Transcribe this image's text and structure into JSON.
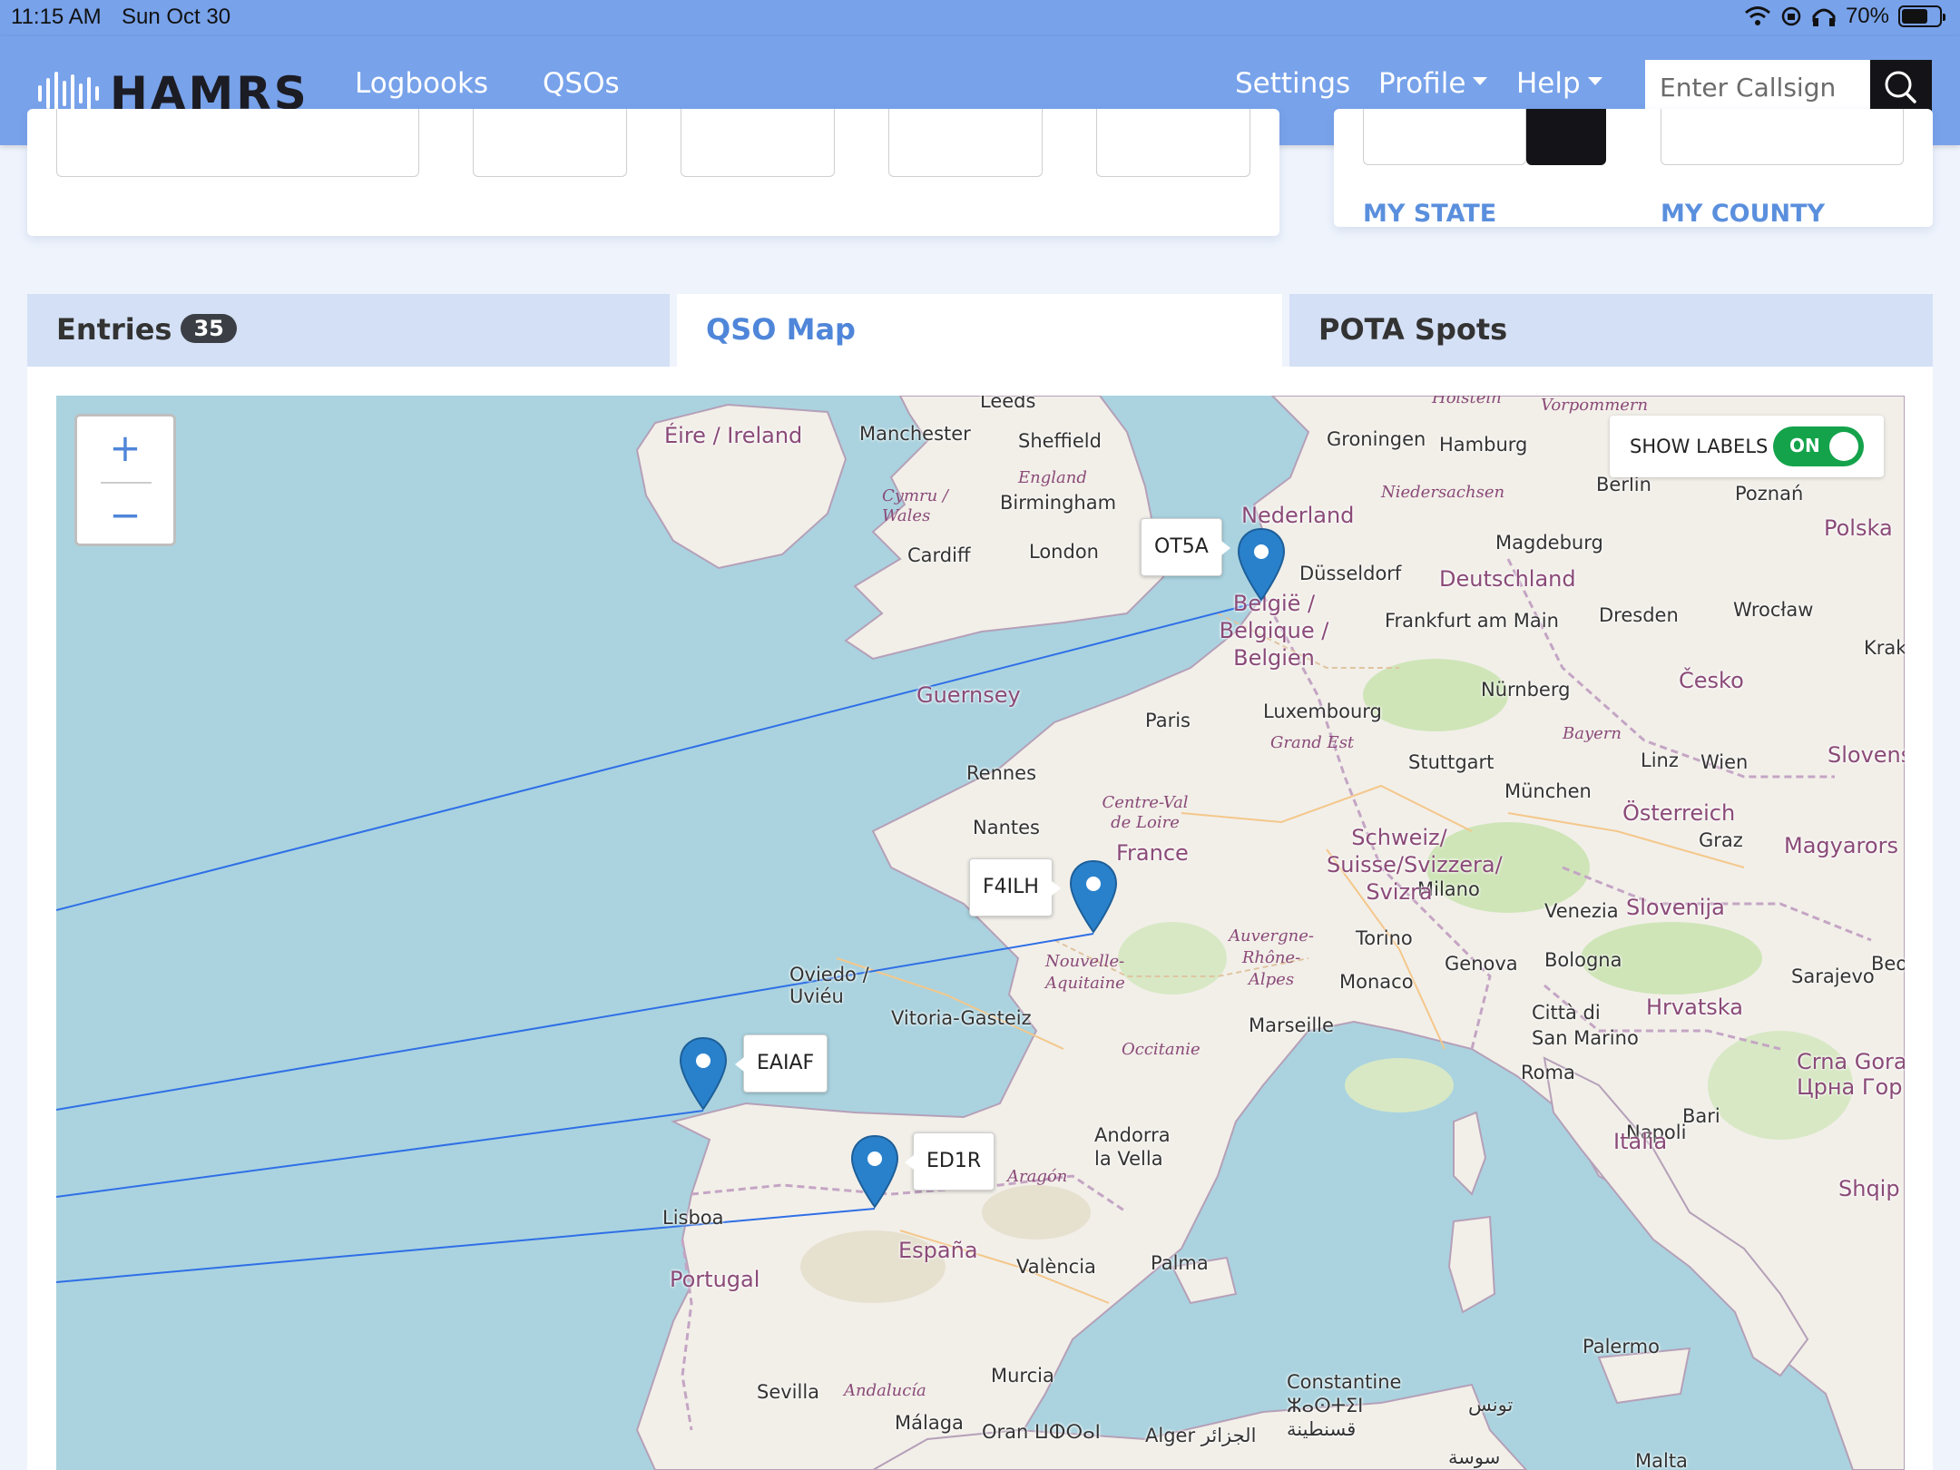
{
  "status_bar": {
    "time": "11:15 AM",
    "date": "Sun Oct 30",
    "battery": "70%",
    "battery_level": 0.7,
    "icons": [
      "wifi-icon",
      "orientation-lock-icon",
      "headphones-icon",
      "battery-icon"
    ]
  },
  "navbar": {
    "brand": "HAMRS",
    "links": [
      "Logbooks",
      "QSOs"
    ],
    "settings": "Settings",
    "profile": "Profile",
    "help": "Help",
    "search_placeholder": "Enter Callsign",
    "background_color": "#78a2ea"
  },
  "station_card": {
    "my_state": "MY STATE",
    "my_county": "MY COUNTY"
  },
  "tabs": {
    "entries": "Entries",
    "entries_count": "35",
    "qso_map": "QSO Map",
    "pota_spots": "POTA Spots",
    "active": "QSO Map"
  },
  "map": {
    "zoom_in": "+",
    "zoom_out": "−",
    "show_labels": "SHOW LABELS",
    "labels_state": "ON",
    "toggle_color": "#14a34b",
    "line_color": "#2f6fe6",
    "marker_color": "#2a81cb",
    "qsos": [
      "OT5A",
      "F4ILH",
      "EAIAF",
      "ED1R"
    ],
    "countries": [
      "Éire / Ireland",
      "Nederland",
      "België / Belgique / Belgien",
      "Deutschland",
      "France",
      "España",
      "Portugal",
      "Italia",
      "Polska",
      "Česko",
      "Österreich",
      "Schweiz/ Suisse/Svizzera/ Svizra",
      "Slovenija",
      "Hrvatska",
      "Magyarors",
      "Andorra la Vella",
      "Guernsey",
      "Slovens",
      "Crna Gora Црна Гор",
      "Shqip"
    ],
    "cities": [
      "Leeds",
      "Manchester",
      "Sheffield",
      "Birmingham",
      "Cardiff",
      "London",
      "Groningen",
      "Hamburg",
      "Berlin",
      "Poznań",
      "Magdeburg",
      "Düsseldorf",
      "Frankfurt am Main",
      "Dresden",
      "Wrocław",
      "Krak",
      "Paris",
      "Luxembourg",
      "Nürnberg",
      "Stuttgart",
      "Linz",
      "Wien",
      "München",
      "Rennes",
      "Nantes",
      "Graz",
      "Milano",
      "Venezia",
      "Torino",
      "Genova",
      "Bologna",
      "Monaco",
      "Marseille",
      "Città di San Marino",
      "Sarajevo",
      "Oviedo / Uviéu",
      "Vitoria-Gasteiz",
      "Roma",
      "Bari",
      "Napoli",
      "Lisboa",
      "Palma",
      "València",
      "Sevilla",
      "Málaga",
      "Murcia",
      "Oran ⵡⵀⵔⴰⵏ",
      "Alger الجزائر",
      "Constantine ⵣⴰⵙⵜⵉⵏ قسنطينة",
      "تونس",
      "Palermo",
      "Malta",
      "Beo",
      "سوسة"
    ],
    "regions": [
      "England",
      "Cymru / Wales",
      "Niedersachsen",
      "Vorpommern",
      "Holstein",
      "Bayern",
      "Grand Est",
      "Centre-Val de Loire",
      "Nouvelle-Aquitaine",
      "Auvergne-Rhône-Alpes",
      "Occitanie",
      "Aragón",
      "Andalucía"
    ]
  }
}
